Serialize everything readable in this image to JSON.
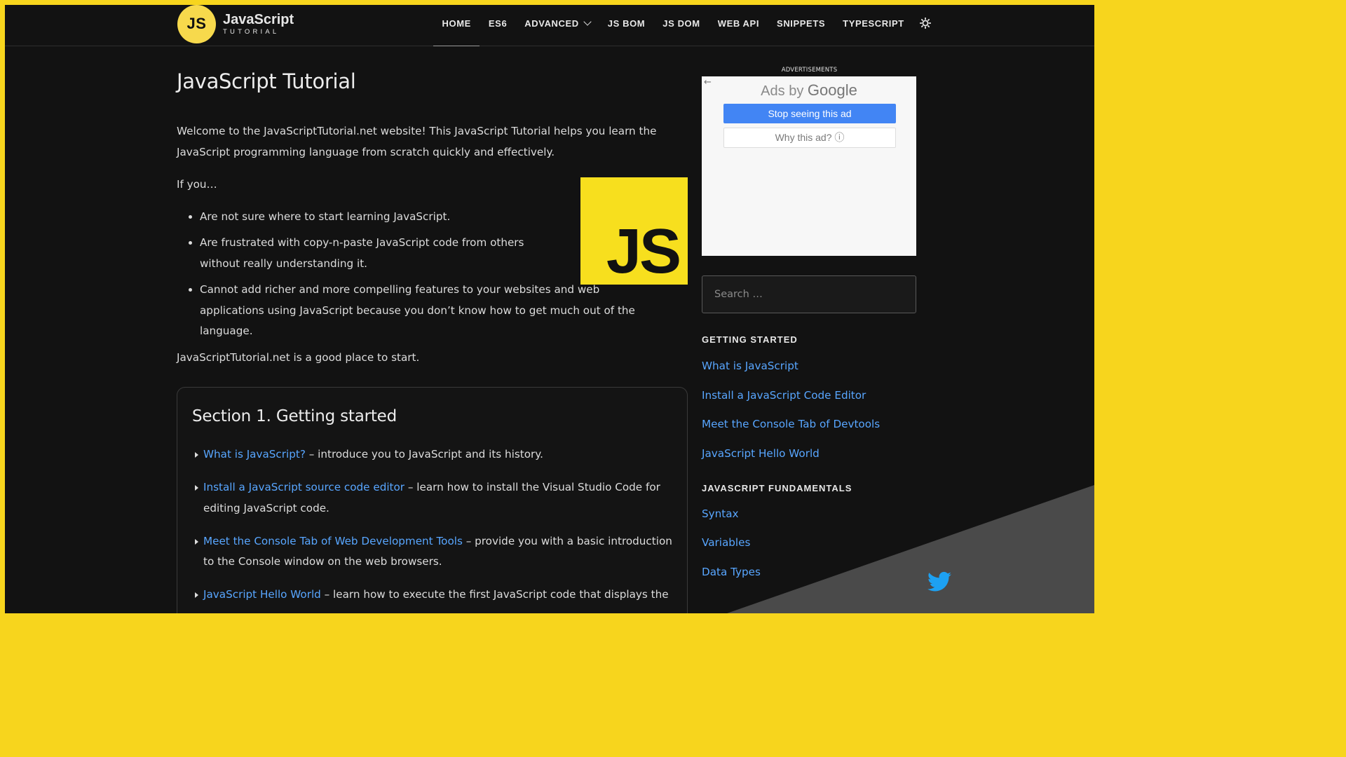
{
  "logo": {
    "badge": "JS",
    "title": "JavaScript",
    "subtitle": "TUTORIAL"
  },
  "nav": {
    "items": [
      {
        "label": "HOME"
      },
      {
        "label": "ES6"
      },
      {
        "label": "ADVANCED"
      },
      {
        "label": "JS BOM"
      },
      {
        "label": "JS DOM"
      },
      {
        "label": "WEB API"
      },
      {
        "label": "SNIPPETS"
      },
      {
        "label": "TYPESCRIPT"
      }
    ],
    "active": "HOME",
    "theme_icon": "sun-icon"
  },
  "main": {
    "title": "JavaScript Tutorial",
    "intro": "Welcome to the JavaScriptTutorial.net website! This JavaScript Tutorial helps you learn the JavaScript programming language from scratch quickly and effectively.",
    "if_you": "If you…",
    "bullets": [
      "Are not sure where to start learning JavaScript.",
      "Are frustrated with copy-n-paste JavaScript code from others without really understanding it.",
      "Cannot add richer and more compelling features to your websites and web applications using JavaScript because you don’t know how to get much out of the language."
    ],
    "good_place": "JavaScriptTutorial.net is a good place to start.",
    "js_logo_text": "JS",
    "section": {
      "title": "Section 1. Getting started",
      "items": [
        {
          "link": "What is JavaScript?",
          "desc": " – introduce you to JavaScript and its history."
        },
        {
          "link": "Install a JavaScript source code editor",
          "desc": " – learn how to install the Visual Studio Code for editing JavaScript code."
        },
        {
          "link": "Meet the Console Tab of Web Development Tools",
          "desc": " – provide you with a basic introduction to the Console window on the web browsers."
        },
        {
          "link": "JavaScript Hello World",
          "desc": " – learn how to execute the first JavaScript code that displays the"
        }
      ]
    }
  },
  "sidebar": {
    "ads_label": "ADVERTISEMENTS",
    "ad": {
      "title_prefix": "Ads by ",
      "title_brand": "Google",
      "stop_button": "Stop seeing this ad",
      "why_button": "Why this ad? ⓘ"
    },
    "search_placeholder": "Search …",
    "getting_started": {
      "heading": "GETTING STARTED",
      "items": [
        "What is JavaScript",
        "Install a JavaScript Code Editor",
        "Meet the Console Tab of Devtools",
        "JavaScript Hello World"
      ]
    },
    "fundamentals": {
      "heading": "JAVASCRIPT FUNDAMENTALS",
      "items": [
        "Syntax",
        "Variables",
        "Data Types"
      ]
    }
  },
  "colors": {
    "border": "#f7d51d",
    "background": "#121212",
    "link": "#58a6ff",
    "js_yellow": "#f7df1e",
    "ad_button": "#4285f4",
    "twitter": "#1da1f2"
  },
  "share_icon": "twitter-icon"
}
